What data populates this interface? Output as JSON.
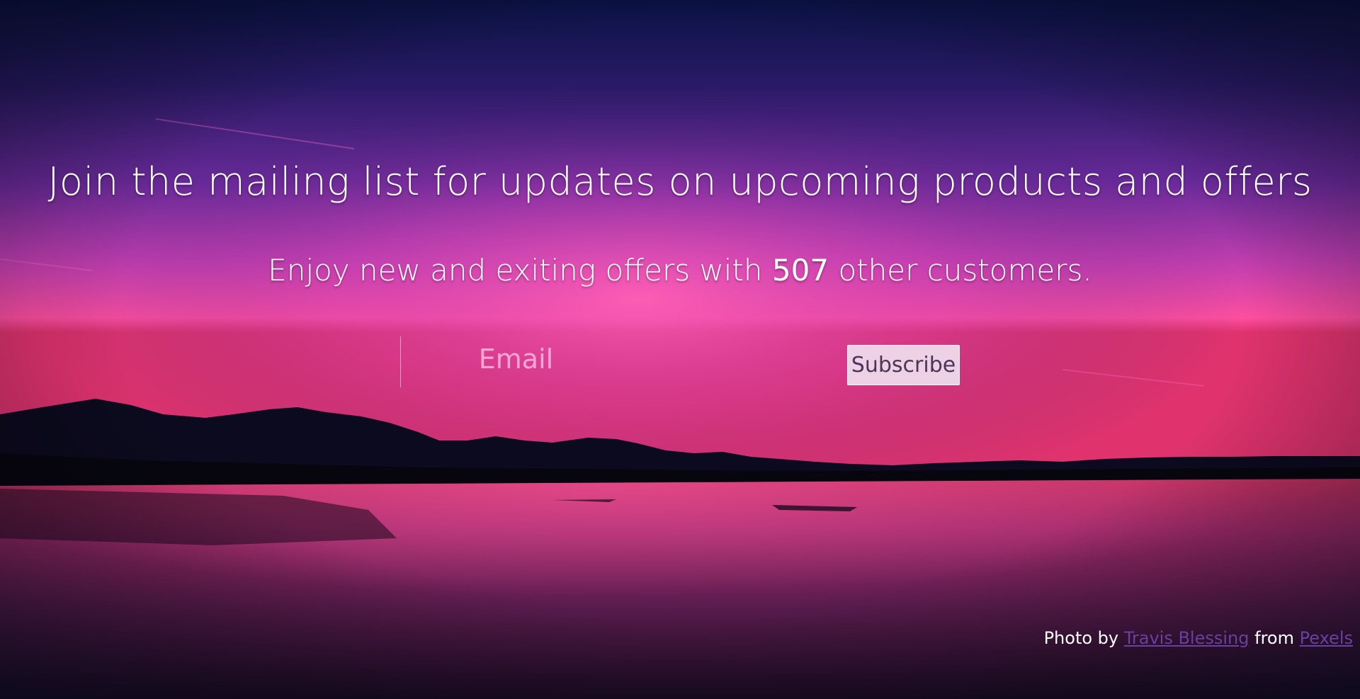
{
  "background": {
    "photo_subject": "sunset over mountains and lake",
    "colors": {
      "sky_top": "#0a1244",
      "sky_mid": "#6a2a9a",
      "glow": "#ff4fa8",
      "mountains": "#0c0a1e",
      "water": "#7a1e5a"
    }
  },
  "headline": {
    "text": "Join the mailing list for updates on upcoming products and offers"
  },
  "subline": {
    "prefix": "Enjoy new and exiting offers with",
    "count": "507",
    "suffix": "other customers."
  },
  "form": {
    "email_placeholder": "Email",
    "email_value": "",
    "subscribe_label": "Subscribe"
  },
  "credit": {
    "prefix": "Photo by",
    "author": "Travis Blessing",
    "middle": "from",
    "source": "Pexels"
  },
  "colors": {
    "text": "#ffffff",
    "button_bg": "#f0deee",
    "button_text": "#4a3658",
    "link": "#6b3fa0"
  }
}
